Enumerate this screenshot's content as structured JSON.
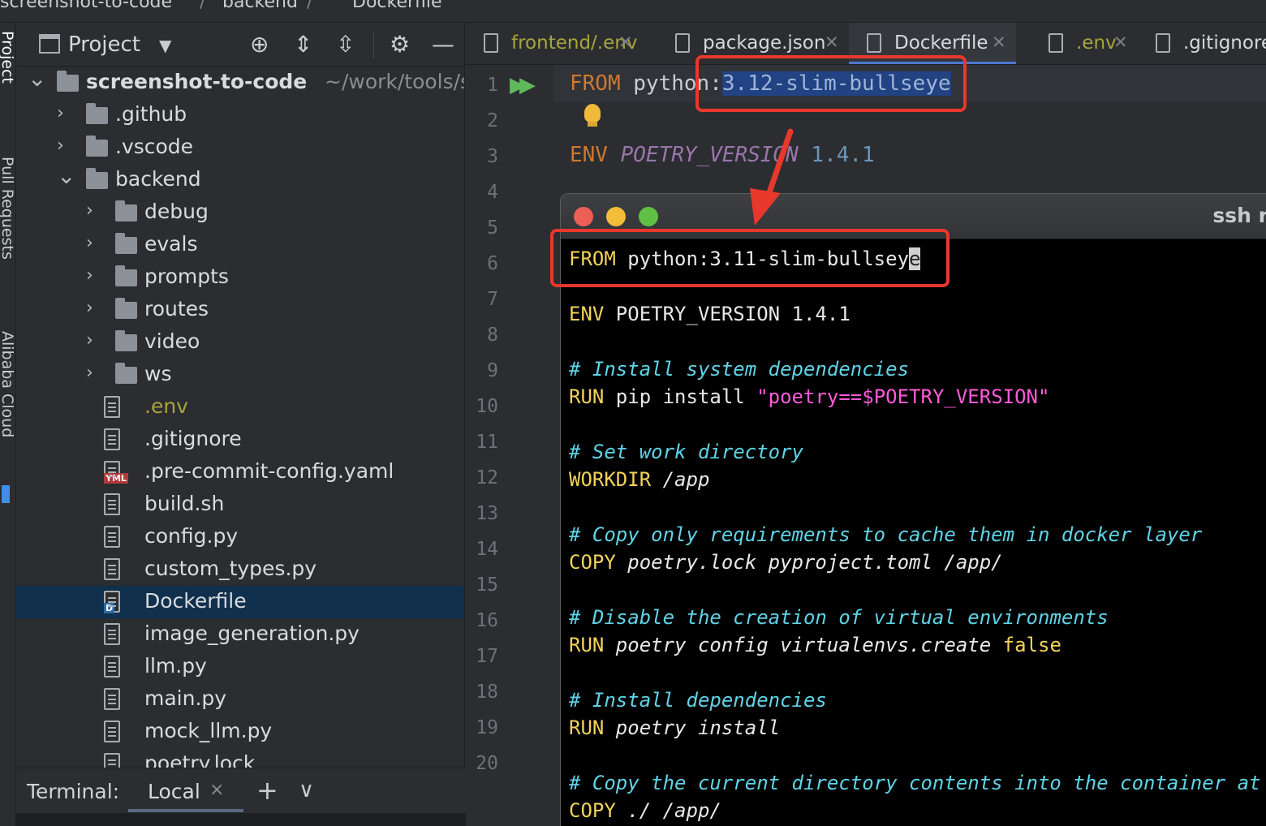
{
  "breadcrumb": {
    "project": "screenshot-to-code",
    "sep1": "/",
    "folder": "backend",
    "sep2": "/",
    "file": "Dockerfile"
  },
  "side_strip": {
    "label1": "Project",
    "label2": "Pull Requests",
    "label3": "Alibaba Cloud"
  },
  "project_panel": {
    "title": "Project",
    "root": {
      "name": "screenshot-to-code",
      "path": "~/work/tools/sc"
    },
    "tree": [
      {
        "label": "screenshot-to-code",
        "kind": "root"
      },
      {
        "label": ".github",
        "kind": "folder",
        "depth": 1,
        "open": false
      },
      {
        "label": ".vscode",
        "kind": "folder",
        "depth": 1,
        "open": false
      },
      {
        "label": "backend",
        "kind": "folder",
        "depth": 1,
        "open": true
      },
      {
        "label": "debug",
        "kind": "folder",
        "depth": 2,
        "open": false
      },
      {
        "label": "evals",
        "kind": "folder",
        "depth": 2,
        "open": false
      },
      {
        "label": "prompts",
        "kind": "folder",
        "depth": 2,
        "open": false
      },
      {
        "label": "routes",
        "kind": "folder",
        "depth": 2,
        "open": false
      },
      {
        "label": "video",
        "kind": "folder",
        "depth": 2,
        "open": false
      },
      {
        "label": "ws",
        "kind": "folder",
        "depth": 2,
        "open": false
      },
      {
        "label": ".env",
        "kind": "file",
        "depth": 2,
        "color": "#a8a43c"
      },
      {
        "label": ".gitignore",
        "kind": "file",
        "depth": 2
      },
      {
        "label": ".pre-commit-config.yaml",
        "kind": "yaml",
        "depth": 2,
        "tag": "YML"
      },
      {
        "label": "build.sh",
        "kind": "shell",
        "depth": 2
      },
      {
        "label": "config.py",
        "kind": "file",
        "depth": 2
      },
      {
        "label": "custom_types.py",
        "kind": "file",
        "depth": 2
      },
      {
        "label": "Dockerfile",
        "kind": "docker",
        "depth": 2,
        "selected": true,
        "tag": "D"
      },
      {
        "label": "image_generation.py",
        "kind": "file",
        "depth": 2
      },
      {
        "label": "llm.py",
        "kind": "file",
        "depth": 2
      },
      {
        "label": "main.py",
        "kind": "file",
        "depth": 2
      },
      {
        "label": "mock_llm.py",
        "kind": "file",
        "depth": 2
      },
      {
        "label": "poetry.lock",
        "kind": "file",
        "depth": 2
      }
    ]
  },
  "terminal": {
    "label": "Terminal:",
    "tab": "Local",
    "close": "×",
    "add": "+",
    "menu": "∨"
  },
  "editor_tabs": [
    {
      "label": "frontend/.env",
      "color": "#a8a43c",
      "active": false
    },
    {
      "label": "package.json",
      "color": "#d6d8dc",
      "active": false
    },
    {
      "label": "Dockerfile",
      "color": "#d6d8dc",
      "active": true
    },
    {
      "label": ".env",
      "color": "#a8a43c",
      "active": false
    },
    {
      "label": ".gitignore",
      "color": "#d6d8dc",
      "active": false
    }
  ],
  "editor": {
    "line_numbers": [
      "1",
      "2",
      "3",
      "4",
      "5",
      "6",
      "7",
      "8",
      "9",
      "10",
      "11",
      "12",
      "13",
      "14",
      "15",
      "16",
      "17",
      "18",
      "19",
      "20"
    ],
    "line1": {
      "kw": "FROM",
      "plain": " python:",
      "sel": "3.12-slim-bullseye"
    },
    "line3": {
      "kw": "ENV",
      "var": " POETRY_VERSION",
      "num": " 1.4.1"
    }
  },
  "ssh": {
    "title": "ssh r",
    "lines": [
      {
        "kw": "FROM",
        "rest": " python:3.11-slim-bullsey",
        "cursor": "e"
      },
      {
        "kw": "ENV",
        "rest": " POETRY_VERSION 1.4.1"
      },
      {
        "cm": "# Install system dependencies"
      },
      {
        "kw": "RUN",
        "rest": " pip install ",
        "str": "\"poetry==$POETRY_VERSION\""
      },
      {
        "cm": "# Set work directory"
      },
      {
        "kw": "WORKDIR",
        "rest": " /app"
      },
      {
        "cm": "# Copy only requirements to cache them in docker layer"
      },
      {
        "kw": "COPY",
        "rest": " poetry.lock pyproject.toml /app/"
      },
      {
        "cm": "# Disable the creation of virtual environments"
      },
      {
        "kw": "RUN",
        "rest": " poetry config virtualenvs.create ",
        "kw2": "false"
      },
      {
        "cm": "# Install dependencies"
      },
      {
        "kw": "RUN",
        "rest": " poetry install"
      },
      {
        "cm": "# Copy the current directory contents into the container at /"
      },
      {
        "kw": "COPY",
        "rest": " ./ /app/"
      }
    ]
  },
  "colors": {
    "annotation": "#e8382b",
    "selection": "#214283",
    "keyword_editor": "#cc7832"
  }
}
